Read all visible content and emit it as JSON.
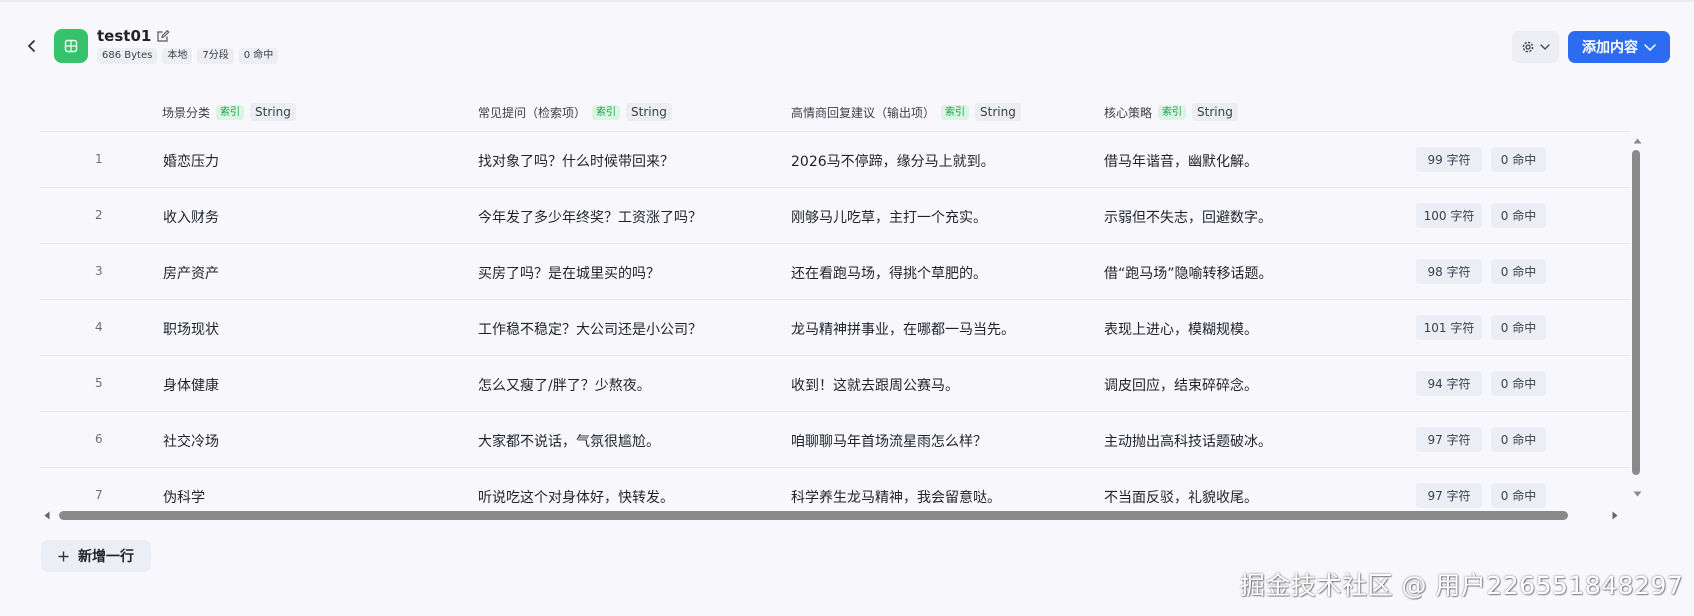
{
  "header": {
    "title": "test01",
    "meta": [
      "686 Bytes",
      "本地",
      "7分段",
      "0 命中"
    ],
    "add_button_label": "添加内容"
  },
  "table": {
    "columns": [
      {
        "label": "场景分类",
        "tag": "索引",
        "type": "String"
      },
      {
        "label": "常见提问（检索项）",
        "tag": "索引",
        "type": "String"
      },
      {
        "label": "高情商回复建议（输出项）",
        "tag": "索引",
        "type": "String"
      },
      {
        "label": "核心策略",
        "tag": "索引",
        "type": "String"
      }
    ],
    "rows": [
      {
        "num": "1",
        "c1": "婚恋压力",
        "c2": "找对象了吗？什么时候带回来？",
        "c3": "2026马不停蹄，缘分马上就到。",
        "c4": "借马年谐音，幽默化解。",
        "chars": "99 字符",
        "hits": "0 命中"
      },
      {
        "num": "2",
        "c1": "收入财务",
        "c2": "今年发了多少年终奖？工资涨了吗？",
        "c3": "刚够马儿吃草，主打一个充实。",
        "c4": "示弱但不失志，回避数字。",
        "chars": "100 字符",
        "hits": "0 命中"
      },
      {
        "num": "3",
        "c1": "房产资产",
        "c2": "买房了吗？是在城里买的吗？",
        "c3": "还在看跑马场，得挑个草肥的。",
        "c4": "借“跑马场”隐喻转移话题。",
        "chars": "98 字符",
        "hits": "0 命中"
      },
      {
        "num": "4",
        "c1": "职场现状",
        "c2": "工作稳不稳定？大公司还是小公司？",
        "c3": "龙马精神拼事业，在哪都一马当先。",
        "c4": "表现上进心，模糊规模。",
        "chars": "101 字符",
        "hits": "0 命中"
      },
      {
        "num": "5",
        "c1": "身体健康",
        "c2": "怎么又瘦了/胖了？少熬夜。",
        "c3": "收到！这就去跟周公赛马。",
        "c4": "调皮回应，结束碎碎念。",
        "chars": "94 字符",
        "hits": "0 命中"
      },
      {
        "num": "6",
        "c1": "社交冷场",
        "c2": "大家都不说话，气氛很尴尬。",
        "c3": "咱聊聊马年首场流星雨怎么样？",
        "c4": "主动抛出高科技话题破冰。",
        "chars": "97 字符",
        "hits": "0 命中"
      },
      {
        "num": "7",
        "c1": "伪科学",
        "c2": "听说吃这个对身体好，快转发。",
        "c3": "科学养生龙马精神，我会留意哒。",
        "c4": "不当面反驳，礼貌收尾。",
        "chars": "97 字符",
        "hits": "0 命中"
      }
    ]
  },
  "add_row_label": "新增一行",
  "watermark": "掘金技术社区 @ 用户226551848297",
  "colors": {
    "accent": "#2b6cf0",
    "logo": "#35c26b",
    "index_tag_text": "#14a34c",
    "index_tag_bg": "#dcf5e3"
  },
  "icons": {
    "back": "chevron-left-icon",
    "logo": "table-icon",
    "edit": "edit-icon",
    "settings": "gear-icon",
    "dropdown": "chevron-down-icon",
    "add": "plus-icon"
  }
}
